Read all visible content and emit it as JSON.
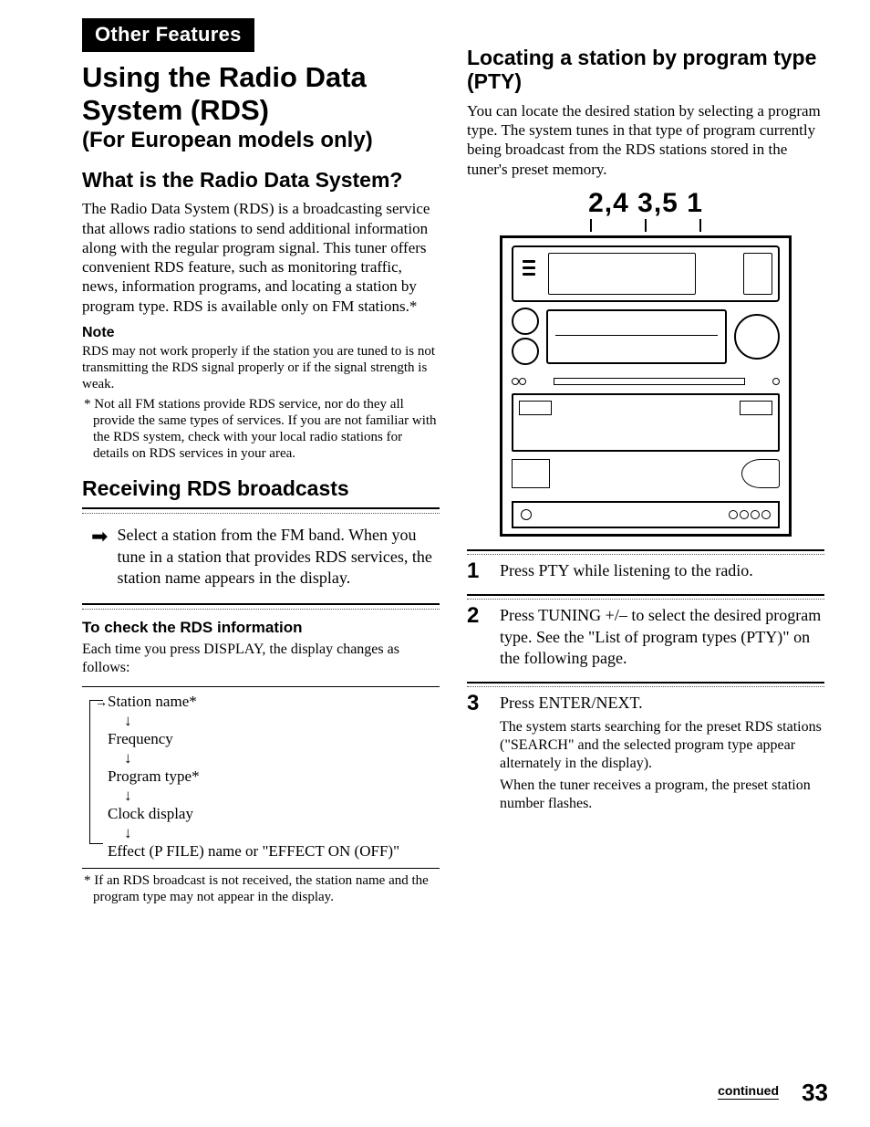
{
  "tab": "Other Features",
  "title": "Using the Radio Data System (RDS)",
  "subtitle": "(For European models only)",
  "left": {
    "h_what": "What is the Radio Data System?",
    "p_what": "The Radio Data System (RDS) is a broadcasting service that allows radio stations to send additional information along with the regular program signal. This tuner offers convenient RDS feature, such as monitoring traffic, news, information programs, and locating a station by program type. RDS is available only on FM stations.*",
    "note_label": "Note",
    "note_body": "RDS may not work properly if the station you are tuned to is not transmitting the RDS signal properly or if the signal strength is weak.",
    "foot1": "* Not all FM stations provide RDS service, nor do they all provide the same types of services. If you are not familiar with the RDS system, check with your local radio stations for details on RDS services in your area.",
    "h_recv": "Receiving RDS broadcasts",
    "arrow_text": "Select a station from the FM band. When you tune in a station that provides RDS services, the station name appears in the display.",
    "h_check": "To check the RDS information",
    "p_check": "Each time you press DISPLAY, the display changes as follows:",
    "cycle": {
      "i1": "Station name*",
      "i2": "Frequency",
      "i3": "Program type*",
      "i4": "Clock display",
      "i5": "Effect (P FILE) name or \"EFFECT ON (OFF)\""
    },
    "foot2": "* If an RDS broadcast is not received, the station name and the program type may not appear in the display."
  },
  "right": {
    "h_loc": "Locating a station by program type (PTY)",
    "p_loc": "You can locate the desired station by selecting a program type. The system tunes in that type of program currently being broadcast from the RDS stations stored in the tuner's preset memory.",
    "callout": "2,4  3,5  1",
    "steps": [
      {
        "n": "1",
        "main": "Press PTY while listening to the radio."
      },
      {
        "n": "2",
        "main": "Press TUNING +/– to select the desired program type. See the \"List of program types (PTY)\" on the following page."
      },
      {
        "n": "3",
        "main": "Press ENTER/NEXT.",
        "sub1": "The system starts searching for the preset RDS stations (\"SEARCH\" and the selected program type appear alternately in the display).",
        "sub2": "When the tuner receives a program, the preset station number flashes."
      }
    ]
  },
  "continued": "continued",
  "pagenum": "33"
}
